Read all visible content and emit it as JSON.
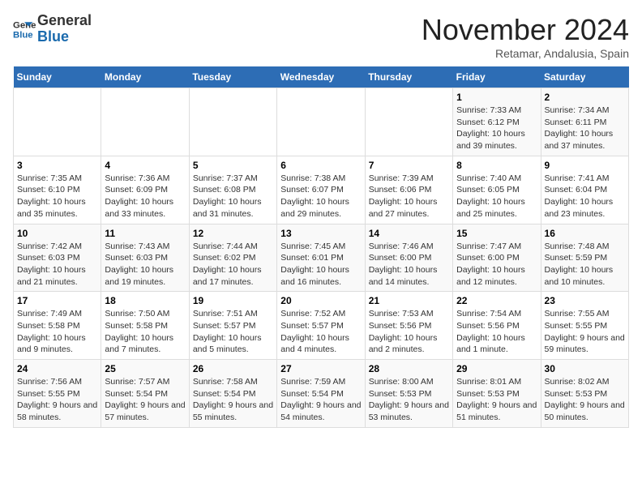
{
  "header": {
    "logo": {
      "general": "General",
      "blue": "Blue"
    },
    "title": "November 2024",
    "location": "Retamar, Andalusia, Spain"
  },
  "calendar": {
    "weekdays": [
      "Sunday",
      "Monday",
      "Tuesday",
      "Wednesday",
      "Thursday",
      "Friday",
      "Saturday"
    ],
    "weeks": [
      [
        {
          "day": "",
          "info": ""
        },
        {
          "day": "",
          "info": ""
        },
        {
          "day": "",
          "info": ""
        },
        {
          "day": "",
          "info": ""
        },
        {
          "day": "",
          "info": ""
        },
        {
          "day": "1",
          "info": "Sunrise: 7:33 AM\nSunset: 6:12 PM\nDaylight: 10 hours and 39 minutes."
        },
        {
          "day": "2",
          "info": "Sunrise: 7:34 AM\nSunset: 6:11 PM\nDaylight: 10 hours and 37 minutes."
        }
      ],
      [
        {
          "day": "3",
          "info": "Sunrise: 7:35 AM\nSunset: 6:10 PM\nDaylight: 10 hours and 35 minutes."
        },
        {
          "day": "4",
          "info": "Sunrise: 7:36 AM\nSunset: 6:09 PM\nDaylight: 10 hours and 33 minutes."
        },
        {
          "day": "5",
          "info": "Sunrise: 7:37 AM\nSunset: 6:08 PM\nDaylight: 10 hours and 31 minutes."
        },
        {
          "day": "6",
          "info": "Sunrise: 7:38 AM\nSunset: 6:07 PM\nDaylight: 10 hours and 29 minutes."
        },
        {
          "day": "7",
          "info": "Sunrise: 7:39 AM\nSunset: 6:06 PM\nDaylight: 10 hours and 27 minutes."
        },
        {
          "day": "8",
          "info": "Sunrise: 7:40 AM\nSunset: 6:05 PM\nDaylight: 10 hours and 25 minutes."
        },
        {
          "day": "9",
          "info": "Sunrise: 7:41 AM\nSunset: 6:04 PM\nDaylight: 10 hours and 23 minutes."
        }
      ],
      [
        {
          "day": "10",
          "info": "Sunrise: 7:42 AM\nSunset: 6:03 PM\nDaylight: 10 hours and 21 minutes."
        },
        {
          "day": "11",
          "info": "Sunrise: 7:43 AM\nSunset: 6:03 PM\nDaylight: 10 hours and 19 minutes."
        },
        {
          "day": "12",
          "info": "Sunrise: 7:44 AM\nSunset: 6:02 PM\nDaylight: 10 hours and 17 minutes."
        },
        {
          "day": "13",
          "info": "Sunrise: 7:45 AM\nSunset: 6:01 PM\nDaylight: 10 hours and 16 minutes."
        },
        {
          "day": "14",
          "info": "Sunrise: 7:46 AM\nSunset: 6:00 PM\nDaylight: 10 hours and 14 minutes."
        },
        {
          "day": "15",
          "info": "Sunrise: 7:47 AM\nSunset: 6:00 PM\nDaylight: 10 hours and 12 minutes."
        },
        {
          "day": "16",
          "info": "Sunrise: 7:48 AM\nSunset: 5:59 PM\nDaylight: 10 hours and 10 minutes."
        }
      ],
      [
        {
          "day": "17",
          "info": "Sunrise: 7:49 AM\nSunset: 5:58 PM\nDaylight: 10 hours and 9 minutes."
        },
        {
          "day": "18",
          "info": "Sunrise: 7:50 AM\nSunset: 5:58 PM\nDaylight: 10 hours and 7 minutes."
        },
        {
          "day": "19",
          "info": "Sunrise: 7:51 AM\nSunset: 5:57 PM\nDaylight: 10 hours and 5 minutes."
        },
        {
          "day": "20",
          "info": "Sunrise: 7:52 AM\nSunset: 5:57 PM\nDaylight: 10 hours and 4 minutes."
        },
        {
          "day": "21",
          "info": "Sunrise: 7:53 AM\nSunset: 5:56 PM\nDaylight: 10 hours and 2 minutes."
        },
        {
          "day": "22",
          "info": "Sunrise: 7:54 AM\nSunset: 5:56 PM\nDaylight: 10 hours and 1 minute."
        },
        {
          "day": "23",
          "info": "Sunrise: 7:55 AM\nSunset: 5:55 PM\nDaylight: 9 hours and 59 minutes."
        }
      ],
      [
        {
          "day": "24",
          "info": "Sunrise: 7:56 AM\nSunset: 5:55 PM\nDaylight: 9 hours and 58 minutes."
        },
        {
          "day": "25",
          "info": "Sunrise: 7:57 AM\nSunset: 5:54 PM\nDaylight: 9 hours and 57 minutes."
        },
        {
          "day": "26",
          "info": "Sunrise: 7:58 AM\nSunset: 5:54 PM\nDaylight: 9 hours and 55 minutes."
        },
        {
          "day": "27",
          "info": "Sunrise: 7:59 AM\nSunset: 5:54 PM\nDaylight: 9 hours and 54 minutes."
        },
        {
          "day": "28",
          "info": "Sunrise: 8:00 AM\nSunset: 5:53 PM\nDaylight: 9 hours and 53 minutes."
        },
        {
          "day": "29",
          "info": "Sunrise: 8:01 AM\nSunset: 5:53 PM\nDaylight: 9 hours and 51 minutes."
        },
        {
          "day": "30",
          "info": "Sunrise: 8:02 AM\nSunset: 5:53 PM\nDaylight: 9 hours and 50 minutes."
        }
      ]
    ]
  }
}
